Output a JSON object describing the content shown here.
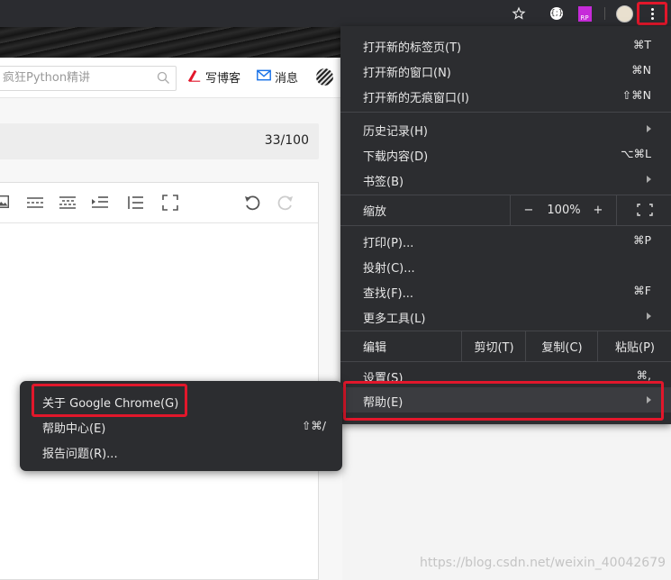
{
  "header": {
    "search_placeholder": "疯狂Python精讲",
    "write_blog_label": "写博客",
    "messages_label": "消息"
  },
  "editor": {
    "title_counter": "33/100"
  },
  "chrome_menu": {
    "new_tab": {
      "label": "打开新的标签页(T)",
      "shortcut": "⌘T"
    },
    "new_window": {
      "label": "打开新的窗口(N)",
      "shortcut": "⌘N"
    },
    "new_incognito": {
      "label": "打开新的无痕窗口(I)",
      "shortcut": "⇧⌘N"
    },
    "history": {
      "label": "历史记录(H)"
    },
    "downloads": {
      "label": "下载内容(D)",
      "shortcut": "⌥⌘L"
    },
    "bookmarks": {
      "label": "书签(B)"
    },
    "zoom": {
      "label": "缩放",
      "minus": "−",
      "value": "100%",
      "plus": "+"
    },
    "print": {
      "label": "打印(P)...",
      "shortcut": "⌘P"
    },
    "cast": {
      "label": "投射(C)..."
    },
    "find": {
      "label": "查找(F)...",
      "shortcut": "⌘F"
    },
    "more_tools": {
      "label": "更多工具(L)"
    },
    "edit": {
      "label": "编辑",
      "cut": "剪切(T)",
      "copy": "复制(C)",
      "paste": "粘贴(P)"
    },
    "settings": {
      "label": "设置(S)",
      "shortcut": "⌘,"
    },
    "help": {
      "label": "帮助(E)"
    }
  },
  "help_submenu": {
    "about": {
      "label": "关于 Google Chrome(G)"
    },
    "help_center": {
      "label": "帮助中心(E)",
      "shortcut": "⇧⌘/"
    },
    "report_issue": {
      "label": "报告问题(R)..."
    }
  },
  "extensions": {
    "ext1_glyph": "{;}",
    "ext2_label": "RP"
  },
  "watermark": "https://blog.csdn.net/weixin_40042679",
  "colors": {
    "menu_bg": "#2c2d30",
    "highlight_red": "#e2172b",
    "write_icon_red": "#e2172b",
    "message_icon_blue": "#1a73e8"
  }
}
